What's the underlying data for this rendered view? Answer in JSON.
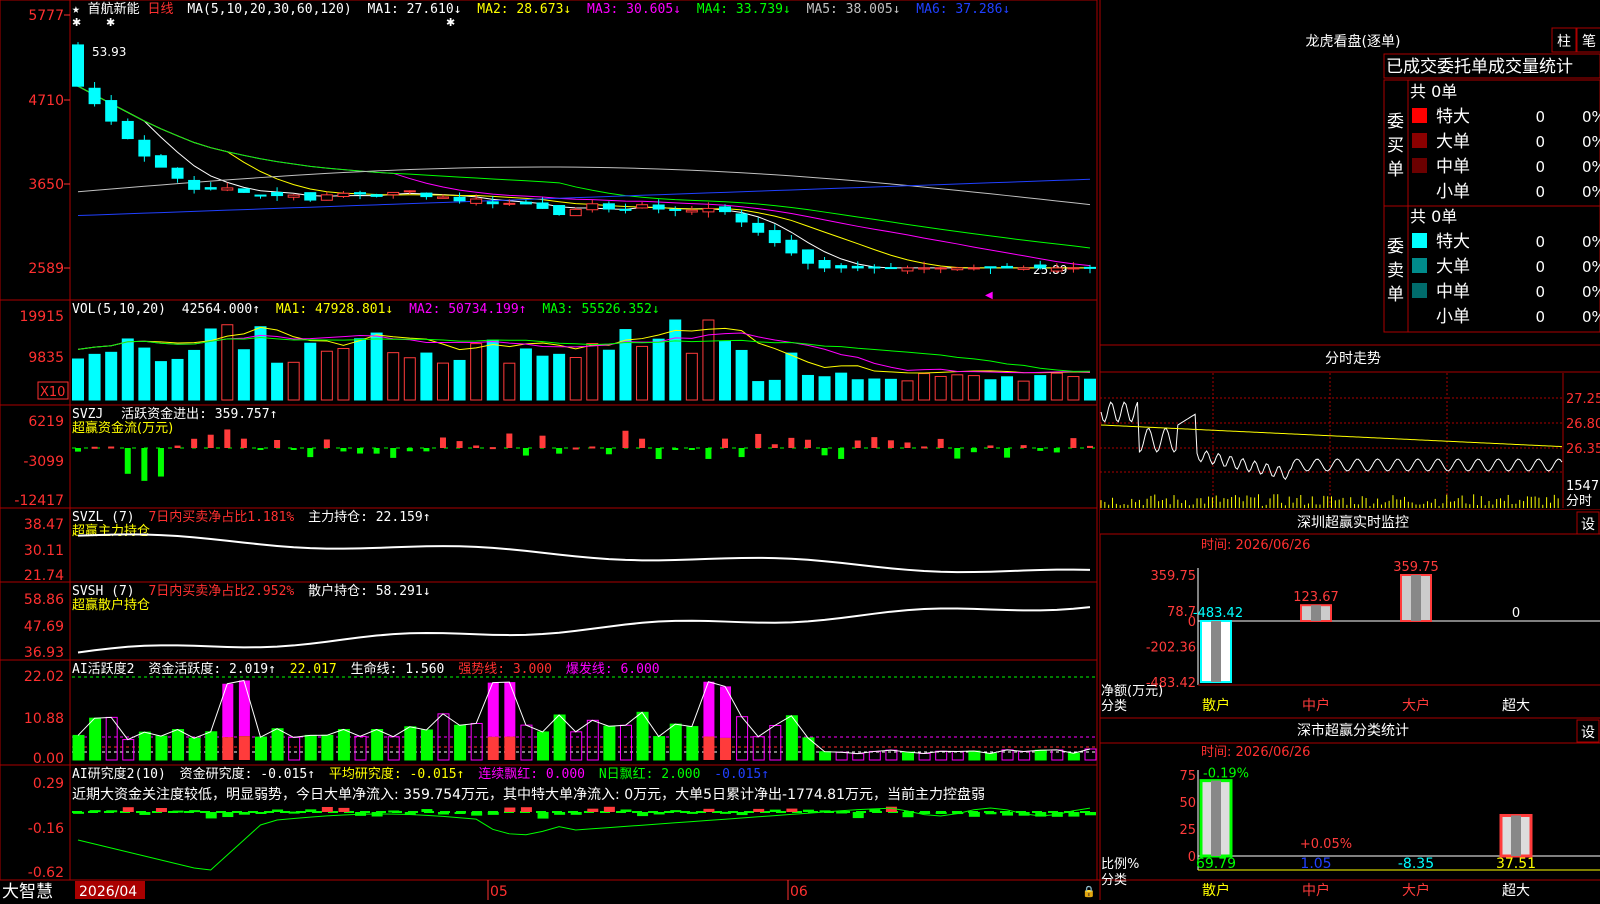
{
  "colors": {
    "up": "#ff3b3b",
    "down": "#00ffff",
    "green": "#00ff00",
    "yellow": "#ffff00",
    "magenta": "#ff00ff",
    "white": "#ffffff",
    "blue": "#2040ff",
    "grey": "#c0c0c0",
    "grid": "#aa0000",
    "label": "#ff3030"
  },
  "main": {
    "star": "★",
    "name": "首航新能",
    "period": "日线",
    "ma_header": "MA(5,10,20,30,60,120)",
    "ma1": "MA1: 27.610↓",
    "ma2": "MA2: 28.673↓",
    "ma3": "MA3: 30.605↓",
    "ma4": "MA4: 33.739↓",
    "ma5": "MA5: 38.005↓",
    "ma6": "MA6: 37.286↓",
    "y_ticks": [
      "5777",
      "4710",
      "3650",
      "2589"
    ],
    "high_label": "53.93",
    "low_label": "25.89"
  },
  "vol": {
    "header": "VOL(5,10,20)",
    "value": "42564.000↑",
    "ma1": "MA1: 47928.801↓",
    "ma2": "MA2: 50734.199↑",
    "ma3": "MA3: 55526.352↓",
    "y_ticks": [
      "19915",
      "9835"
    ],
    "unit": "X10"
  },
  "svzj": {
    "header": "SVZJ",
    "line1": "活跃资金进出: 359.757↑",
    "line2": "超赢资金流(万元)",
    "y_ticks": [
      "6219",
      "-3099",
      "-12417"
    ]
  },
  "svzl": {
    "header": "SVZL (7)",
    "line1": "7日内买卖净占比1.181%",
    "line1b": "主力持仓: 22.159↑",
    "line2": "超赢主力持仓",
    "y_ticks": [
      "38.47",
      "30.11",
      "21.74"
    ]
  },
  "svsh": {
    "header": "SVSH (7)",
    "line1": "7日内买卖净占比2.952%",
    "line1b": "散户持仓: 58.291↓",
    "line2": "超赢散户持仓",
    "y_ticks": [
      "58.86",
      "47.69",
      "36.93"
    ]
  },
  "ai_active": {
    "header": "AI活跃度2",
    "a": "资金活跃度: 2.019↑",
    "b": "22.017",
    "c": "生命线: 1.560",
    "d": "强势线: 3.000",
    "e": "爆发线: 6.000",
    "y_ticks": [
      "22.02",
      "10.88",
      "0.00"
    ]
  },
  "ai_research": {
    "header": "AI研究度2(10)",
    "a": "资金研究度: -0.015↑",
    "b": "平均研究度: -0.015↑",
    "c": "连续飘红: 0.000",
    "d": "N日飘红: 2.000",
    "e": "-0.015↑",
    "text": "近期大资金关注度较低，明显弱势，今日大单净流入: 359.754万元，其中特大单净流入: 0万元，大单5日累计净出-1774.81万元，当前主力控盘弱",
    "y_ticks": [
      "0.29",
      "-0.16",
      "-0.62"
    ]
  },
  "bottom": {
    "logo": "大智慧",
    "date": "2026/04",
    "m05": "05",
    "m06": "06"
  },
  "dragon": {
    "title": "龙虎看盘(逐单)",
    "btn1": "柱",
    "btn2": "笔",
    "subtitle": "已成交委托单成交量统计",
    "buy_total": "共 0单",
    "buy_label": "委买单",
    "sell_total": "共 0单",
    "sell_label": "委卖单",
    "rows": [
      {
        "name": "特大",
        "n": "0",
        "p": "0%"
      },
      {
        "name": "大单",
        "n": "0",
        "p": "0%"
      },
      {
        "name": "中单",
        "n": "0",
        "p": "0%"
      },
      {
        "name": "小单",
        "n": "0",
        "p": "0%"
      }
    ]
  },
  "fenshi": {
    "title": "分时走势",
    "prices": [
      "27.25",
      "26.80",
      "26.35"
    ],
    "vol_label": "1547",
    "unit": "分时"
  },
  "sz_monitor": {
    "title": "深圳超赢实时监控",
    "btn": "设",
    "time": "时间: 2026/06/26",
    "y_ticks": [
      "359.75",
      "78.7",
      "0",
      "-202.36",
      "-483.42"
    ],
    "y_unit": "净额(万元)",
    "x_unit": "分类",
    "bars": [
      {
        "cat": "散户",
        "value": -483.42,
        "label": "-483.42"
      },
      {
        "cat": "中户",
        "value": 123.67,
        "label": "123.67"
      },
      {
        "cat": "大户",
        "value": 359.75,
        "label": "359.75"
      },
      {
        "cat": "超大",
        "value": 0,
        "label": "0"
      }
    ]
  },
  "sz_class": {
    "title": "深市超赢分类统计",
    "btn": "设",
    "time": "时间: 2026/06/26",
    "y_ticks": [
      "75",
      "50",
      "25",
      "0"
    ],
    "y_unit": "比例%",
    "x_unit": "分类",
    "bars": [
      {
        "cat": "散户",
        "value": 69.79,
        "label": "69.79",
        "delta": "-0.19%"
      },
      {
        "cat": "中户",
        "value": 1.05,
        "label": "1.05",
        "delta": "+0.05%"
      },
      {
        "cat": "大户",
        "value": -8.35,
        "label": "-8.35",
        "delta": ""
      },
      {
        "cat": "超大",
        "value": 37.51,
        "label": "37.51",
        "delta": ""
      }
    ]
  },
  "chart_data": {
    "type": "bar",
    "title": "深圳超赢实时监控",
    "categories": [
      "散户",
      "中户",
      "大户",
      "超大"
    ],
    "series": [
      {
        "name": "净额(万元)",
        "values": [
          -483.42,
          123.67,
          359.75,
          0
        ]
      },
      {
        "name": "比例%",
        "values": [
          69.79,
          1.05,
          -8.35,
          37.51
        ]
      }
    ],
    "ylabel": "净额(万元)",
    "ylim": [
      -483.42,
      359.75
    ]
  }
}
